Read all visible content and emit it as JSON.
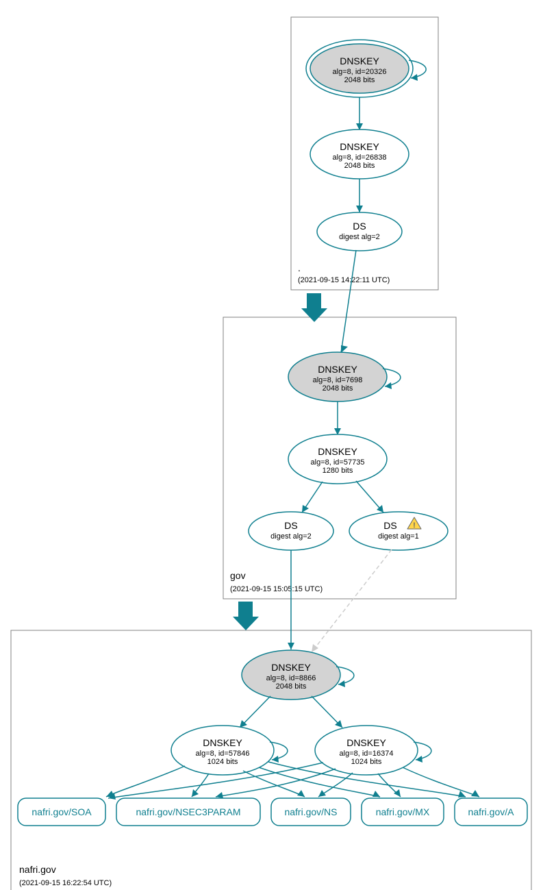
{
  "colors": {
    "teal": "#0f7f8f",
    "ksk_fill": "#d3d3d3",
    "box": "#808080",
    "dashed": "#cccccc",
    "warn": "#ffd54a"
  },
  "zones": {
    "root": {
      "label": ".",
      "time": "(2021-09-15 14:22:11 UTC)"
    },
    "gov": {
      "label": "gov",
      "time": "(2021-09-15 15:05:15 UTC)"
    },
    "nafri": {
      "label": "nafri.gov",
      "time": "(2021-09-15 16:22:54 UTC)"
    }
  },
  "nodes": {
    "root_ksk": {
      "title": "DNSKEY",
      "line1": "alg=8, id=20326",
      "line2": "2048 bits"
    },
    "root_zsk": {
      "title": "DNSKEY",
      "line1": "alg=8, id=26838",
      "line2": "2048 bits"
    },
    "root_ds": {
      "title": "DS",
      "line1": "digest alg=2",
      "line2": ""
    },
    "gov_ksk": {
      "title": "DNSKEY",
      "line1": "alg=8, id=7698",
      "line2": "2048 bits"
    },
    "gov_zsk": {
      "title": "DNSKEY",
      "line1": "alg=8, id=57735",
      "line2": "1280 bits"
    },
    "gov_ds2": {
      "title": "DS",
      "line1": "digest alg=2",
      "line2": ""
    },
    "gov_ds1": {
      "title": "DS",
      "line1": "digest alg=1",
      "line2": ""
    },
    "nafri_ksk": {
      "title": "DNSKEY",
      "line1": "alg=8, id=8866",
      "line2": "2048 bits"
    },
    "nafri_zsk1": {
      "title": "DNSKEY",
      "line1": "alg=8, id=57846",
      "line2": "1024 bits"
    },
    "nafri_zsk2": {
      "title": "DNSKEY",
      "line1": "alg=8, id=16374",
      "line2": "1024 bits"
    }
  },
  "rr": {
    "soa": "nafri.gov/SOA",
    "nsec3param": "nafri.gov/NSEC3PARAM",
    "ns": "nafri.gov/NS",
    "mx": "nafri.gov/MX",
    "a": "nafri.gov/A"
  }
}
